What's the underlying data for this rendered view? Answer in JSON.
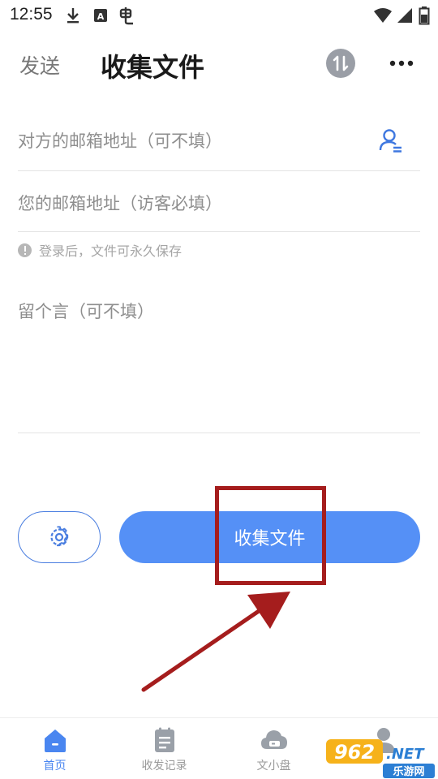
{
  "status_bar": {
    "time": "12:55",
    "left_icons": [
      "download-icon",
      "font-app-icon",
      "bug-icon"
    ],
    "right_icons": [
      "wifi-icon",
      "signal-icon",
      "battery-icon"
    ]
  },
  "header": {
    "tab_send": "发送",
    "title": "收集文件",
    "swap_icon": "swap-vertical-icon",
    "more_icon": "more-dots-icon"
  },
  "form": {
    "recipient_email_placeholder": "对方的邮箱地址（可不填）",
    "contact_icon": "contact-person-icon",
    "your_email_placeholder": "您的邮箱地址（访客必填）",
    "hint": "登录后，文件可永久保存",
    "message_placeholder": "留个言（可不填）"
  },
  "actions": {
    "settings_icon": "gear-icon",
    "collect_label": "收集文件"
  },
  "bottom_nav": [
    {
      "label": "首页",
      "icon": "home-icon",
      "active": true
    },
    {
      "label": "收发记录",
      "icon": "records-icon",
      "active": false
    },
    {
      "label": "文小盘",
      "icon": "cloud-drive-icon",
      "active": false
    },
    {
      "label": "",
      "icon": "profile-icon",
      "active": false
    }
  ],
  "watermark": {
    "brand_number": "962",
    "brand_suffix": ".NET",
    "site_name": "乐游网"
  },
  "colors": {
    "accent": "#5590f6",
    "accent_dark": "#4a7ee0",
    "annotation_red": "#a51d1d",
    "hint_gray": "#a5a5a5"
  }
}
